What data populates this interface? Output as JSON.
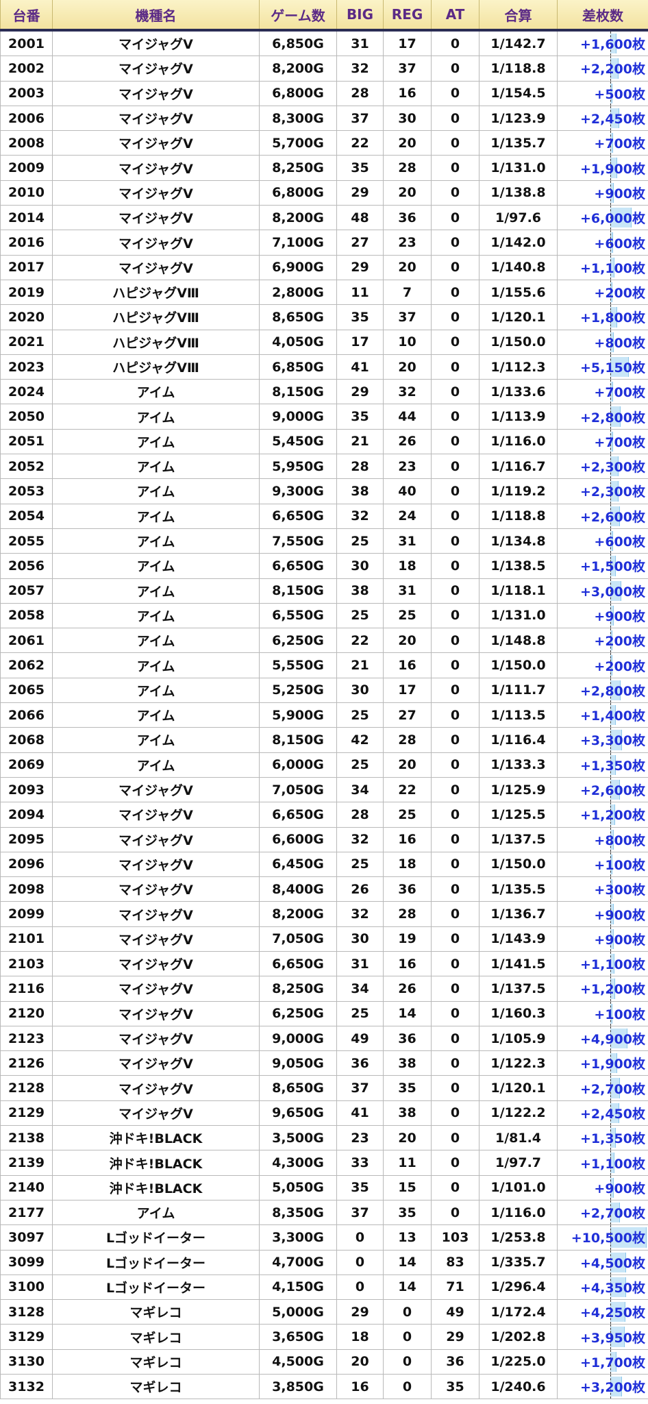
{
  "headers": [
    "台番",
    "機種名",
    "ゲーム数",
    "BIG",
    "REG",
    "AT",
    "合算",
    "差枚数"
  ],
  "rows": [
    [
      "2001",
      "マイジャグV",
      "6,850G",
      "31",
      "17",
      "0",
      "1/142.7",
      "+1,600枚"
    ],
    [
      "2002",
      "マイジャグV",
      "8,200G",
      "32",
      "37",
      "0",
      "1/118.8",
      "+2,200枚"
    ],
    [
      "2003",
      "マイジャグV",
      "6,800G",
      "28",
      "16",
      "0",
      "1/154.5",
      "+500枚"
    ],
    [
      "2006",
      "マイジャグV",
      "8,300G",
      "37",
      "30",
      "0",
      "1/123.9",
      "+2,450枚"
    ],
    [
      "2008",
      "マイジャグV",
      "5,700G",
      "22",
      "20",
      "0",
      "1/135.7",
      "+700枚"
    ],
    [
      "2009",
      "マイジャグV",
      "8,250G",
      "35",
      "28",
      "0",
      "1/131.0",
      "+1,900枚"
    ],
    [
      "2010",
      "マイジャグV",
      "6,800G",
      "29",
      "20",
      "0",
      "1/138.8",
      "+900枚"
    ],
    [
      "2014",
      "マイジャグV",
      "8,200G",
      "48",
      "36",
      "0",
      "1/97.6",
      "+6,000枚"
    ],
    [
      "2016",
      "マイジャグV",
      "7,100G",
      "27",
      "23",
      "0",
      "1/142.0",
      "+600枚"
    ],
    [
      "2017",
      "マイジャグV",
      "6,900G",
      "29",
      "20",
      "0",
      "1/140.8",
      "+1,100枚"
    ],
    [
      "2019",
      "ハピジャグVⅢ",
      "2,800G",
      "11",
      "7",
      "0",
      "1/155.6",
      "+200枚"
    ],
    [
      "2020",
      "ハピジャグVⅢ",
      "8,650G",
      "35",
      "37",
      "0",
      "1/120.1",
      "+1,800枚"
    ],
    [
      "2021",
      "ハピジャグVⅢ",
      "4,050G",
      "17",
      "10",
      "0",
      "1/150.0",
      "+800枚"
    ],
    [
      "2023",
      "ハピジャグVⅢ",
      "6,850G",
      "41",
      "20",
      "0",
      "1/112.3",
      "+5,150枚"
    ],
    [
      "2024",
      "アイム",
      "8,150G",
      "29",
      "32",
      "0",
      "1/133.6",
      "+700枚"
    ],
    [
      "2050",
      "アイム",
      "9,000G",
      "35",
      "44",
      "0",
      "1/113.9",
      "+2,800枚"
    ],
    [
      "2051",
      "アイム",
      "5,450G",
      "21",
      "26",
      "0",
      "1/116.0",
      "+700枚"
    ],
    [
      "2052",
      "アイム",
      "5,950G",
      "28",
      "23",
      "0",
      "1/116.7",
      "+2,300枚"
    ],
    [
      "2053",
      "アイム",
      "9,300G",
      "38",
      "40",
      "0",
      "1/119.2",
      "+2,300枚"
    ],
    [
      "2054",
      "アイム",
      "6,650G",
      "32",
      "24",
      "0",
      "1/118.8",
      "+2,600枚"
    ],
    [
      "2055",
      "アイム",
      "7,550G",
      "25",
      "31",
      "0",
      "1/134.8",
      "+600枚"
    ],
    [
      "2056",
      "アイム",
      "6,650G",
      "30",
      "18",
      "0",
      "1/138.5",
      "+1,500枚"
    ],
    [
      "2057",
      "アイム",
      "8,150G",
      "38",
      "31",
      "0",
      "1/118.1",
      "+3,000枚"
    ],
    [
      "2058",
      "アイム",
      "6,550G",
      "25",
      "25",
      "0",
      "1/131.0",
      "+900枚"
    ],
    [
      "2061",
      "アイム",
      "6,250G",
      "22",
      "20",
      "0",
      "1/148.8",
      "+200枚"
    ],
    [
      "2062",
      "アイム",
      "5,550G",
      "21",
      "16",
      "0",
      "1/150.0",
      "+200枚"
    ],
    [
      "2065",
      "アイム",
      "5,250G",
      "30",
      "17",
      "0",
      "1/111.7",
      "+2,800枚"
    ],
    [
      "2066",
      "アイム",
      "5,900G",
      "25",
      "27",
      "0",
      "1/113.5",
      "+1,400枚"
    ],
    [
      "2068",
      "アイム",
      "8,150G",
      "42",
      "28",
      "0",
      "1/116.4",
      "+3,300枚"
    ],
    [
      "2069",
      "アイム",
      "6,000G",
      "25",
      "20",
      "0",
      "1/133.3",
      "+1,350枚"
    ],
    [
      "2093",
      "マイジャグV",
      "7,050G",
      "34",
      "22",
      "0",
      "1/125.9",
      "+2,600枚"
    ],
    [
      "2094",
      "マイジャグV",
      "6,650G",
      "28",
      "25",
      "0",
      "1/125.5",
      "+1,200枚"
    ],
    [
      "2095",
      "マイジャグV",
      "6,600G",
      "32",
      "16",
      "0",
      "1/137.5",
      "+800枚"
    ],
    [
      "2096",
      "マイジャグV",
      "6,450G",
      "25",
      "18",
      "0",
      "1/150.0",
      "+100枚"
    ],
    [
      "2098",
      "マイジャグV",
      "8,400G",
      "26",
      "36",
      "0",
      "1/135.5",
      "+300枚"
    ],
    [
      "2099",
      "マイジャグV",
      "8,200G",
      "32",
      "28",
      "0",
      "1/136.7",
      "+900枚"
    ],
    [
      "2101",
      "マイジャグV",
      "7,050G",
      "30",
      "19",
      "0",
      "1/143.9",
      "+900枚"
    ],
    [
      "2103",
      "マイジャグV",
      "6,650G",
      "31",
      "16",
      "0",
      "1/141.5",
      "+1,100枚"
    ],
    [
      "2116",
      "マイジャグV",
      "8,250G",
      "34",
      "26",
      "0",
      "1/137.5",
      "+1,200枚"
    ],
    [
      "2120",
      "マイジャグV",
      "6,250G",
      "25",
      "14",
      "0",
      "1/160.3",
      "+100枚"
    ],
    [
      "2123",
      "マイジャグV",
      "9,000G",
      "49",
      "36",
      "0",
      "1/105.9",
      "+4,900枚"
    ],
    [
      "2126",
      "マイジャグV",
      "9,050G",
      "36",
      "38",
      "0",
      "1/122.3",
      "+1,900枚"
    ],
    [
      "2128",
      "マイジャグV",
      "8,650G",
      "37",
      "35",
      "0",
      "1/120.1",
      "+2,700枚"
    ],
    [
      "2129",
      "マイジャグV",
      "9,650G",
      "41",
      "38",
      "0",
      "1/122.2",
      "+2,450枚"
    ],
    [
      "2138",
      "沖ドキ!BLACK",
      "3,500G",
      "23",
      "20",
      "0",
      "1/81.4",
      "+1,350枚"
    ],
    [
      "2139",
      "沖ドキ!BLACK",
      "4,300G",
      "33",
      "11",
      "0",
      "1/97.7",
      "+1,100枚"
    ],
    [
      "2140",
      "沖ドキ!BLACK",
      "5,050G",
      "35",
      "15",
      "0",
      "1/101.0",
      "+900枚"
    ],
    [
      "2177",
      "アイム",
      "8,350G",
      "37",
      "35",
      "0",
      "1/116.0",
      "+2,700枚"
    ],
    [
      "3097",
      "Lゴッドイーター",
      "3,300G",
      "0",
      "13",
      "103",
      "1/253.8",
      "+10,500枚"
    ],
    [
      "3099",
      "Lゴッドイーター",
      "4,700G",
      "0",
      "14",
      "83",
      "1/335.7",
      "+4,500枚"
    ],
    [
      "3100",
      "Lゴッドイーター",
      "4,150G",
      "0",
      "14",
      "71",
      "1/296.4",
      "+4,350枚"
    ],
    [
      "3128",
      "マギレコ",
      "5,000G",
      "29",
      "0",
      "49",
      "1/172.4",
      "+4,250枚"
    ],
    [
      "3129",
      "マギレコ",
      "3,650G",
      "18",
      "0",
      "29",
      "1/202.8",
      "+3,950枚"
    ],
    [
      "3130",
      "マギレコ",
      "4,500G",
      "20",
      "0",
      "36",
      "1/225.0",
      "+1,700枚"
    ],
    [
      "3132",
      "マギレコ",
      "3,850G",
      "16",
      "0",
      "35",
      "1/240.6",
      "+3,200枚"
    ]
  ],
  "diff_values": [
    1600,
    2200,
    500,
    2450,
    700,
    1900,
    900,
    6000,
    600,
    1100,
    200,
    1800,
    800,
    5150,
    700,
    2800,
    700,
    2300,
    2300,
    2600,
    600,
    1500,
    3000,
    900,
    200,
    200,
    2800,
    1400,
    3300,
    1350,
    2600,
    1200,
    800,
    100,
    300,
    900,
    900,
    1100,
    1200,
    100,
    4900,
    1900,
    2700,
    2450,
    1350,
    1100,
    900,
    2700,
    10500,
    4500,
    4350,
    4250,
    3950,
    1700,
    3200
  ],
  "colors": {
    "header_bg": "#f6e8ae",
    "header_text": "#5b2a86",
    "diff_text": "#1f2fd8",
    "bar": "#c9e6f7"
  }
}
